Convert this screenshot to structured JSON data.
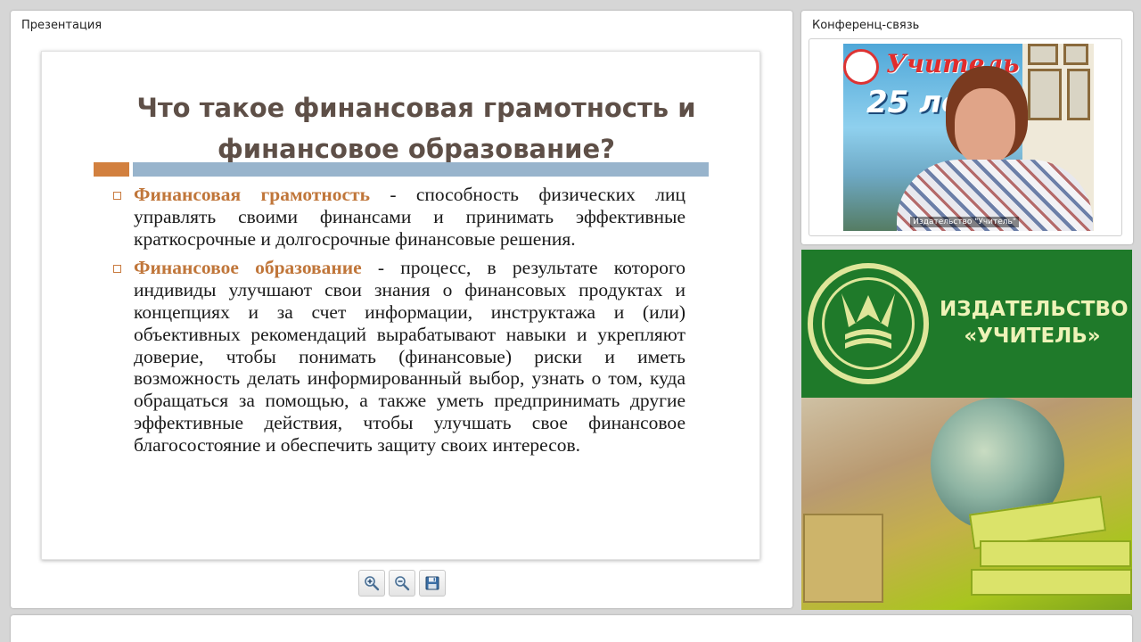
{
  "presentation": {
    "title": "Презентация",
    "slide": {
      "title_line1": "Что такое финансовая грамотность и",
      "title_line2": "финансовое образование?",
      "bullets": [
        {
          "term": "Финансовая грамотность",
          "text": " - способность физических лиц управлять своими финансами и принимать эффективные краткосрочные и долгосрочные финансовые решения."
        },
        {
          "term": "Финансовое образование",
          "text": " - процесс, в результате которого индивиды улучшают свои знания о финансовых продуктах и концепциях и за счет информации, инструктажа и (или) объективных рекомендаций вырабатывают навыки и укрепляют доверие, чтобы понимать (финансовые) риски и иметь возможность делать информированный выбор, узнать о том, куда обращаться за помощью, а также уметь предпринимать другие эффективные действия, чтобы улучшать свое финансовое благосостояние и обеспечить защиту своих интересов."
        }
      ]
    },
    "toolbar": {
      "zoom_in_icon": "zoom-in-icon",
      "zoom_out_icon": "zoom-out-icon",
      "save_icon": "save-icon"
    }
  },
  "conference": {
    "title": "Конференц-связь",
    "video": {
      "caption": "Издательство \"Учитель\"",
      "banner_text": "Учитель",
      "banner_number": "25 ле"
    }
  },
  "publisher": {
    "name_line1": "ИЗДАТЕЛЬСТВО",
    "name_line2": "«УЧИТЕЛЬ»"
  },
  "colors": {
    "accent_orange": "#d2803f",
    "accent_blue": "#98b4cc",
    "term_color": "#c0763a",
    "brand_green": "#1f7a2a"
  }
}
